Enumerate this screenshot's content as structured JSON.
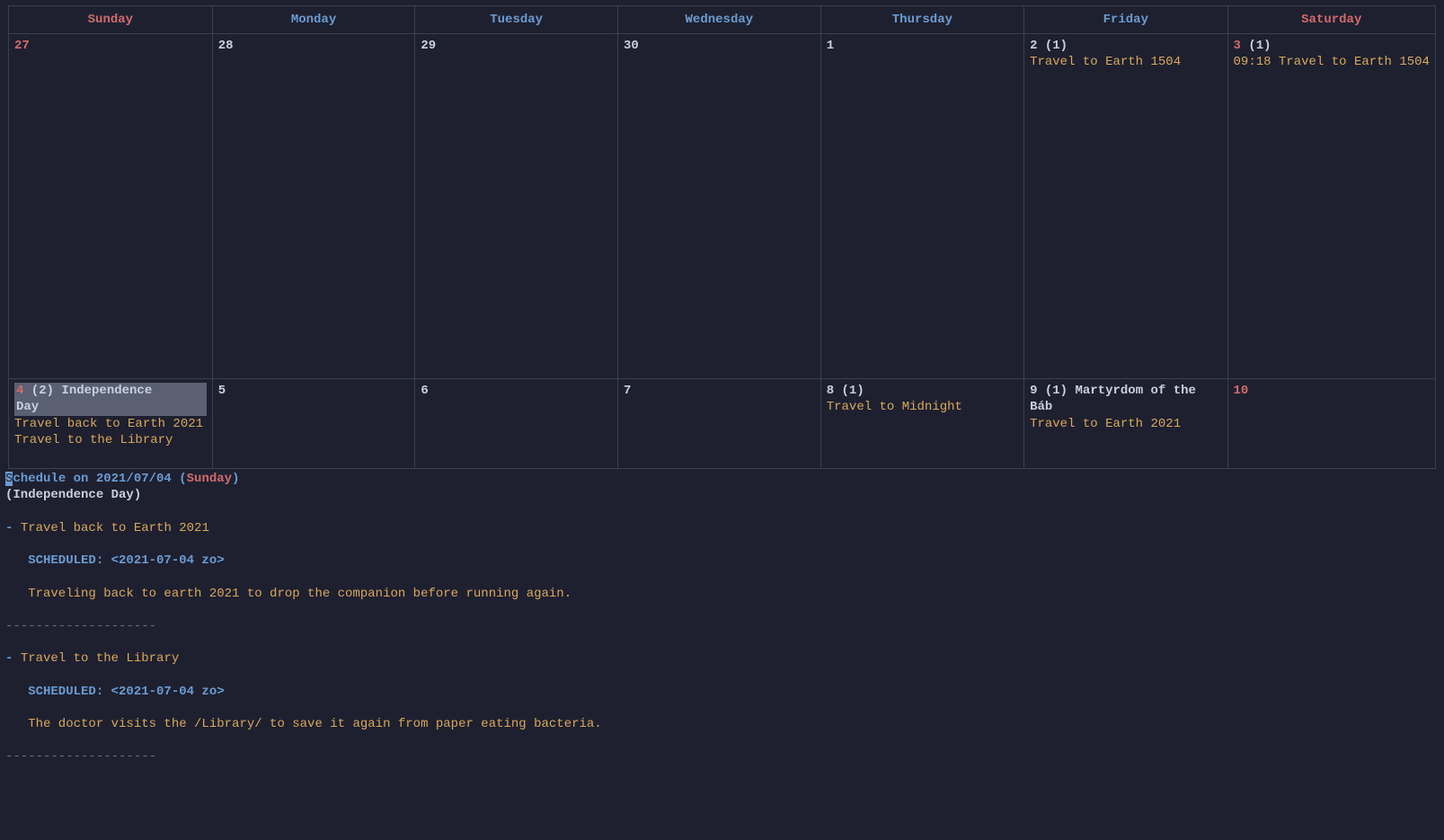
{
  "days_header": [
    "Sunday",
    "Monday",
    "Tuesday",
    "Wednesday",
    "Thursday",
    "Friday",
    "Saturday"
  ],
  "weekend_cols": [
    0,
    6
  ],
  "row1": [
    {
      "num": "27",
      "weekend": true,
      "count": "",
      "holiday": "",
      "events": []
    },
    {
      "num": "28",
      "weekend": false,
      "count": "",
      "holiday": "",
      "events": []
    },
    {
      "num": "29",
      "weekend": false,
      "count": "",
      "holiday": "",
      "events": []
    },
    {
      "num": "30",
      "weekend": false,
      "count": "",
      "holiday": "",
      "events": []
    },
    {
      "num": "1",
      "weekend": false,
      "count": "",
      "holiday": "",
      "events": []
    },
    {
      "num": "2",
      "weekend": false,
      "count": "(1)",
      "holiday": "",
      "events": [
        "Travel to Earth 1504"
      ]
    },
    {
      "num": "3",
      "weekend": true,
      "count": "(1)",
      "holiday": "",
      "events": [
        "09:18 Travel to Earth 1504"
      ]
    }
  ],
  "row2": [
    {
      "num": "4",
      "weekend": true,
      "count": "(2)",
      "holiday": "Independence Day",
      "selected": true,
      "events": [
        "Travel back to Earth 2021",
        "Travel to the Library"
      ]
    },
    {
      "num": "5",
      "weekend": false,
      "count": "",
      "holiday": "",
      "events": []
    },
    {
      "num": "6",
      "weekend": false,
      "count": "",
      "holiday": "",
      "events": []
    },
    {
      "num": "7",
      "weekend": false,
      "count": "",
      "holiday": "",
      "events": []
    },
    {
      "num": "8",
      "weekend": false,
      "count": "(1)",
      "holiday": "",
      "events": [
        "Travel to Midnight"
      ]
    },
    {
      "num": "9",
      "weekend": false,
      "count": "(1)",
      "holiday": "Martyrdom of the Báb",
      "events": [
        "Travel to Earth 2021"
      ]
    },
    {
      "num": "10",
      "weekend": true,
      "count": "",
      "holiday": "",
      "events": []
    }
  ],
  "schedule": {
    "title_prefix": "S",
    "title_rest": "chedule on 2021/07/04 (",
    "title_day": "Sunday",
    "title_close": ")",
    "subtitle": "(Independence Day)",
    "items": [
      {
        "bullet": "- ",
        "title": "Travel back to Earth 2021",
        "sched": "   SCHEDULED: <2021-07-04 zo>",
        "body": "   Traveling back to earth 2021 to drop the companion before running again."
      },
      {
        "bullet": "- ",
        "title": "Travel to the Library",
        "sched": "   SCHEDULED: <2021-07-04 zo>",
        "body": "   The doctor visits the /Library/ to save it again from paper eating bacteria."
      }
    ],
    "sep": "--------------------"
  }
}
